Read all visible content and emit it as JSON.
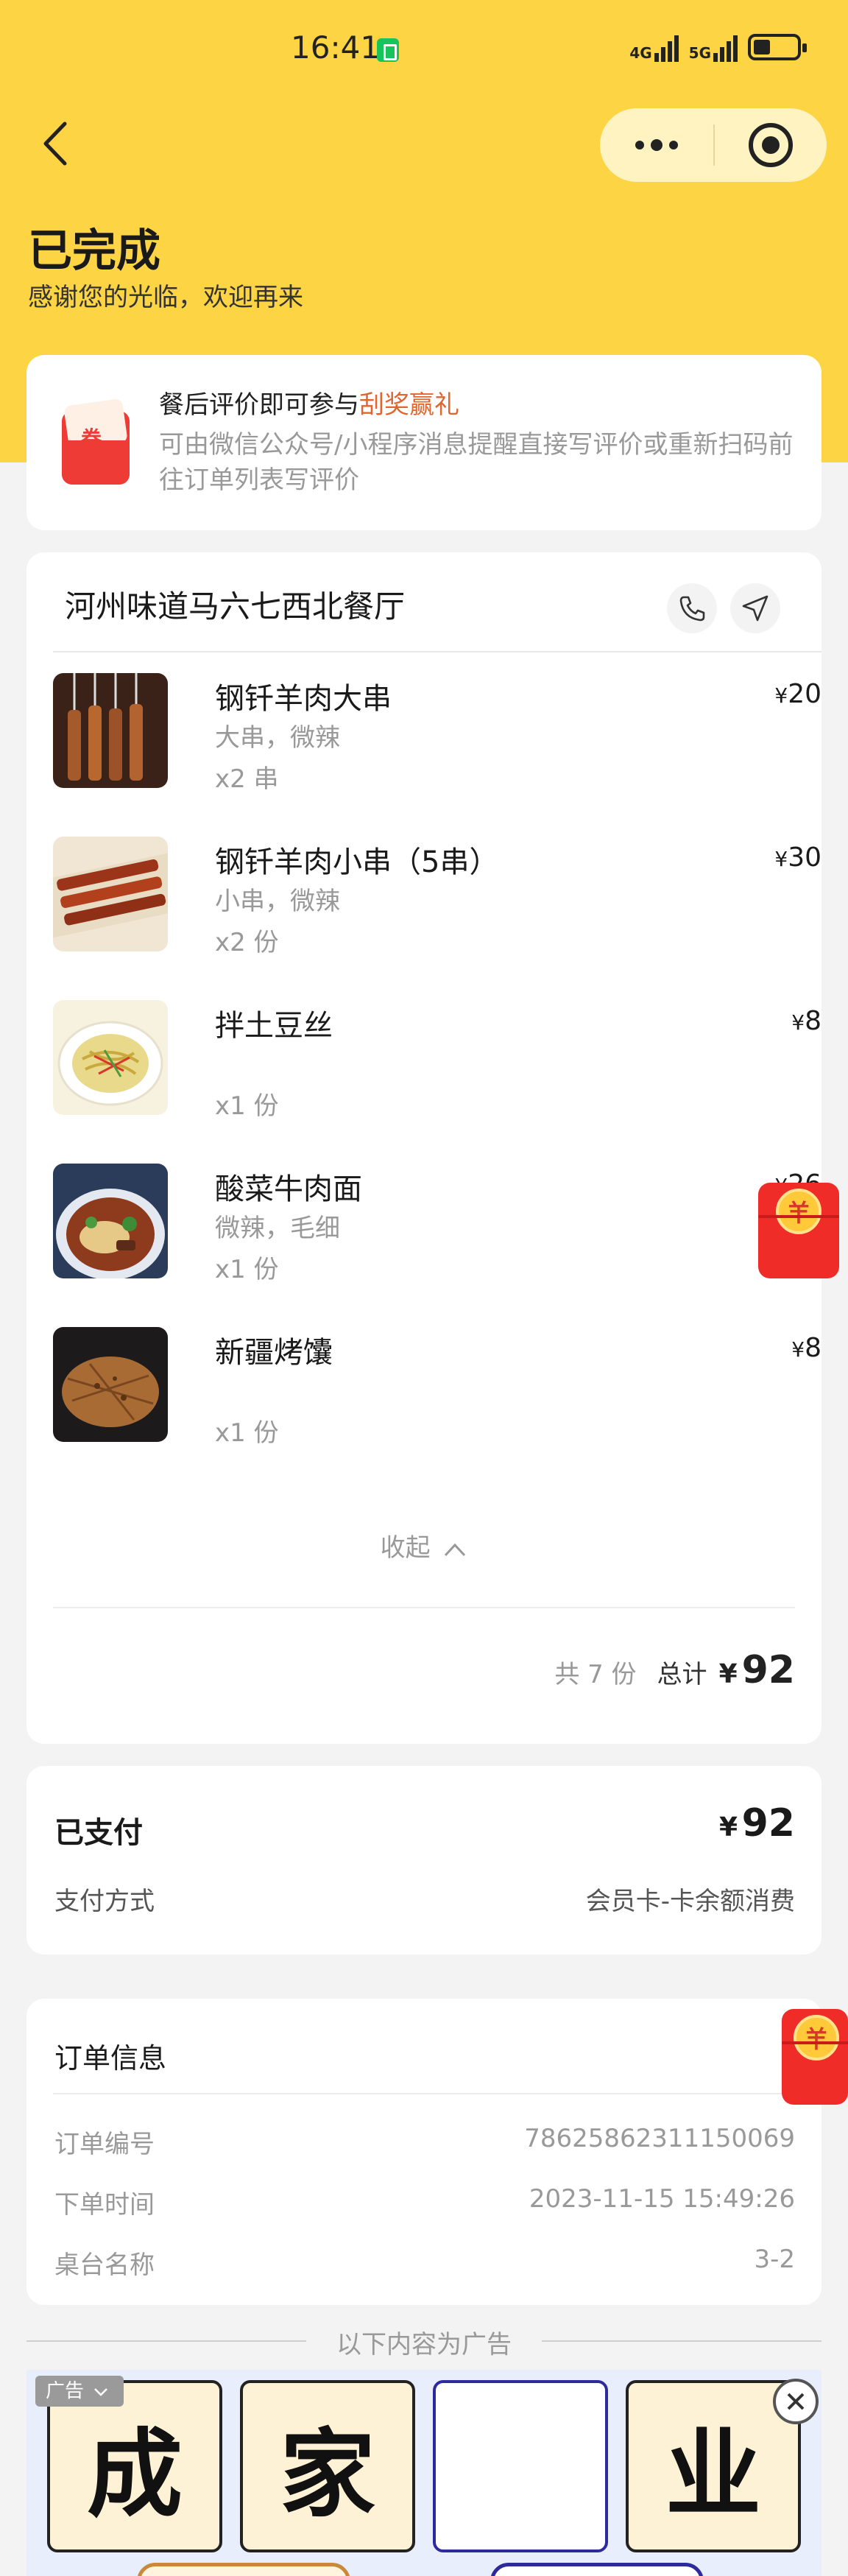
{
  "status_bar": {
    "time": "16:41",
    "network_1": "4G",
    "network_2": "5G"
  },
  "header": {
    "title": "已完成",
    "subtitle": "感谢您的光临，欢迎再来"
  },
  "promo": {
    "coupon_text": "券",
    "title_prefix": "餐后评价即可参与",
    "title_highlight": "刮奖赢礼",
    "description": "可由微信公众号/小程序消息提醒直接写评价或重新扫码前往订单列表写评价"
  },
  "order": {
    "shop_name": "河州味道马六七西北餐厅",
    "items": [
      {
        "name": "钢钎羊肉大串",
        "spec": "大串，微辣",
        "qty": "x2 串",
        "price": "20"
      },
      {
        "name": "钢钎羊肉小串（5串）",
        "spec": "小串，微辣",
        "qty": "x2 份",
        "price": "30"
      },
      {
        "name": "拌土豆丝",
        "spec": "",
        "qty": "x1 份",
        "price": "8"
      },
      {
        "name": "酸菜牛肉面",
        "spec": "微辣，毛细",
        "qty": "x1 份",
        "price": "26"
      },
      {
        "name": "新疆烤馕",
        "spec": "",
        "qty": "x1 份",
        "price": "8"
      }
    ],
    "currency": "¥",
    "collapse_label": "收起",
    "total_count": "共 7 份",
    "total_label": "总计",
    "total_amount": "92"
  },
  "payment": {
    "paid_label": "已支付",
    "paid_amount": "92",
    "method_label": "支付方式",
    "method_value": "会员卡-卡余额消费"
  },
  "info": {
    "title": "订单信息",
    "rows": [
      {
        "label": "订单编号",
        "value": "78625862311150069"
      },
      {
        "label": "下单时间",
        "value": "2023-11-15 15:49:26"
      },
      {
        "label": "桌台名称",
        "value": "3-2"
      }
    ]
  },
  "ad": {
    "separator": "以下内容为广告",
    "tag": "广告",
    "tiles": [
      "成",
      "家",
      "",
      "业"
    ]
  },
  "floating": {
    "coin_symbol": "羊"
  },
  "colors": {
    "brand_yellow": "#fdd443",
    "highlight": "#e1652f",
    "red_packet": "#f02c28"
  }
}
